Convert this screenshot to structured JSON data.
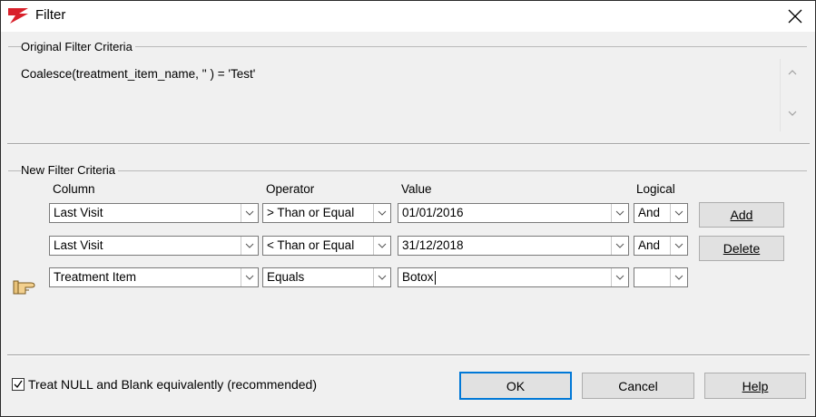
{
  "window": {
    "title": "Filter"
  },
  "original": {
    "group_label": "Original Filter Criteria",
    "expression": "Coalesce(treatment_item_name, '' ) = 'Test'"
  },
  "new": {
    "group_label": "New Filter Criteria",
    "headers": {
      "column": "Column",
      "operator": "Operator",
      "value": "Value",
      "logical": "Logical"
    },
    "rows": [
      {
        "column": "Last Visit",
        "operator": "> Than or Equal",
        "value": "01/01/2016",
        "logical": "And"
      },
      {
        "column": "Last Visit",
        "operator": "< Than or Equal",
        "value": "31/12/2018",
        "logical": "And"
      },
      {
        "column": "Treatment Item",
        "operator": "Equals",
        "value": "Botox",
        "logical": ""
      }
    ]
  },
  "buttons": {
    "add": "Add",
    "delete": "Delete",
    "ok": "OK",
    "cancel": "Cancel",
    "help": "Help"
  },
  "treat_null": {
    "label": "Treat NULL and Blank equivalently (recommended)",
    "checked": true
  },
  "colors": {
    "default_button_border": "#0078d7",
    "icon_red": "#d9202a"
  }
}
